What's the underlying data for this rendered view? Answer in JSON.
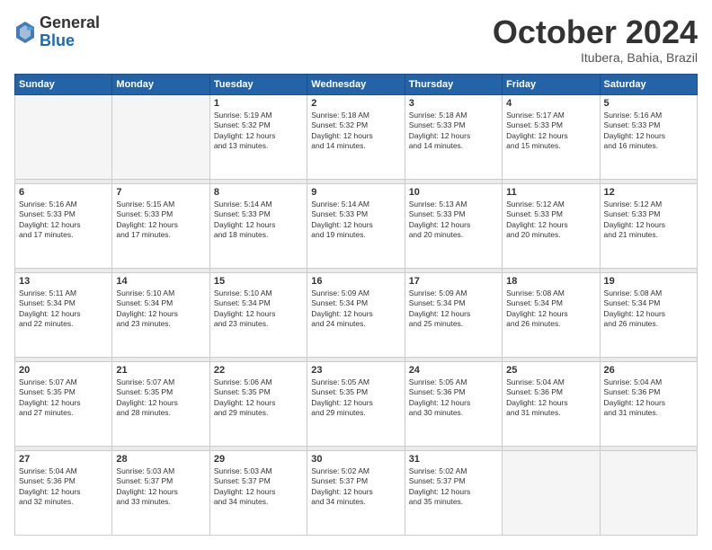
{
  "header": {
    "logo_general": "General",
    "logo_blue": "Blue",
    "month": "October 2024",
    "location": "Itubera, Bahia, Brazil"
  },
  "weekdays": [
    "Sunday",
    "Monday",
    "Tuesday",
    "Wednesday",
    "Thursday",
    "Friday",
    "Saturday"
  ],
  "weeks": [
    [
      {
        "day": "",
        "text": ""
      },
      {
        "day": "",
        "text": ""
      },
      {
        "day": "1",
        "text": "Sunrise: 5:19 AM\nSunset: 5:32 PM\nDaylight: 12 hours\nand 13 minutes."
      },
      {
        "day": "2",
        "text": "Sunrise: 5:18 AM\nSunset: 5:32 PM\nDaylight: 12 hours\nand 14 minutes."
      },
      {
        "day": "3",
        "text": "Sunrise: 5:18 AM\nSunset: 5:33 PM\nDaylight: 12 hours\nand 14 minutes."
      },
      {
        "day": "4",
        "text": "Sunrise: 5:17 AM\nSunset: 5:33 PM\nDaylight: 12 hours\nand 15 minutes."
      },
      {
        "day": "5",
        "text": "Sunrise: 5:16 AM\nSunset: 5:33 PM\nDaylight: 12 hours\nand 16 minutes."
      }
    ],
    [
      {
        "day": "6",
        "text": "Sunrise: 5:16 AM\nSunset: 5:33 PM\nDaylight: 12 hours\nand 17 minutes."
      },
      {
        "day": "7",
        "text": "Sunrise: 5:15 AM\nSunset: 5:33 PM\nDaylight: 12 hours\nand 17 minutes."
      },
      {
        "day": "8",
        "text": "Sunrise: 5:14 AM\nSunset: 5:33 PM\nDaylight: 12 hours\nand 18 minutes."
      },
      {
        "day": "9",
        "text": "Sunrise: 5:14 AM\nSunset: 5:33 PM\nDaylight: 12 hours\nand 19 minutes."
      },
      {
        "day": "10",
        "text": "Sunrise: 5:13 AM\nSunset: 5:33 PM\nDaylight: 12 hours\nand 20 minutes."
      },
      {
        "day": "11",
        "text": "Sunrise: 5:12 AM\nSunset: 5:33 PM\nDaylight: 12 hours\nand 20 minutes."
      },
      {
        "day": "12",
        "text": "Sunrise: 5:12 AM\nSunset: 5:33 PM\nDaylight: 12 hours\nand 21 minutes."
      }
    ],
    [
      {
        "day": "13",
        "text": "Sunrise: 5:11 AM\nSunset: 5:34 PM\nDaylight: 12 hours\nand 22 minutes."
      },
      {
        "day": "14",
        "text": "Sunrise: 5:10 AM\nSunset: 5:34 PM\nDaylight: 12 hours\nand 23 minutes."
      },
      {
        "day": "15",
        "text": "Sunrise: 5:10 AM\nSunset: 5:34 PM\nDaylight: 12 hours\nand 23 minutes."
      },
      {
        "day": "16",
        "text": "Sunrise: 5:09 AM\nSunset: 5:34 PM\nDaylight: 12 hours\nand 24 minutes."
      },
      {
        "day": "17",
        "text": "Sunrise: 5:09 AM\nSunset: 5:34 PM\nDaylight: 12 hours\nand 25 minutes."
      },
      {
        "day": "18",
        "text": "Sunrise: 5:08 AM\nSunset: 5:34 PM\nDaylight: 12 hours\nand 26 minutes."
      },
      {
        "day": "19",
        "text": "Sunrise: 5:08 AM\nSunset: 5:34 PM\nDaylight: 12 hours\nand 26 minutes."
      }
    ],
    [
      {
        "day": "20",
        "text": "Sunrise: 5:07 AM\nSunset: 5:35 PM\nDaylight: 12 hours\nand 27 minutes."
      },
      {
        "day": "21",
        "text": "Sunrise: 5:07 AM\nSunset: 5:35 PM\nDaylight: 12 hours\nand 28 minutes."
      },
      {
        "day": "22",
        "text": "Sunrise: 5:06 AM\nSunset: 5:35 PM\nDaylight: 12 hours\nand 29 minutes."
      },
      {
        "day": "23",
        "text": "Sunrise: 5:05 AM\nSunset: 5:35 PM\nDaylight: 12 hours\nand 29 minutes."
      },
      {
        "day": "24",
        "text": "Sunrise: 5:05 AM\nSunset: 5:36 PM\nDaylight: 12 hours\nand 30 minutes."
      },
      {
        "day": "25",
        "text": "Sunrise: 5:04 AM\nSunset: 5:36 PM\nDaylight: 12 hours\nand 31 minutes."
      },
      {
        "day": "26",
        "text": "Sunrise: 5:04 AM\nSunset: 5:36 PM\nDaylight: 12 hours\nand 31 minutes."
      }
    ],
    [
      {
        "day": "27",
        "text": "Sunrise: 5:04 AM\nSunset: 5:36 PM\nDaylight: 12 hours\nand 32 minutes."
      },
      {
        "day": "28",
        "text": "Sunrise: 5:03 AM\nSunset: 5:37 PM\nDaylight: 12 hours\nand 33 minutes."
      },
      {
        "day": "29",
        "text": "Sunrise: 5:03 AM\nSunset: 5:37 PM\nDaylight: 12 hours\nand 34 minutes."
      },
      {
        "day": "30",
        "text": "Sunrise: 5:02 AM\nSunset: 5:37 PM\nDaylight: 12 hours\nand 34 minutes."
      },
      {
        "day": "31",
        "text": "Sunrise: 5:02 AM\nSunset: 5:37 PM\nDaylight: 12 hours\nand 35 minutes."
      },
      {
        "day": "",
        "text": ""
      },
      {
        "day": "",
        "text": ""
      }
    ]
  ]
}
